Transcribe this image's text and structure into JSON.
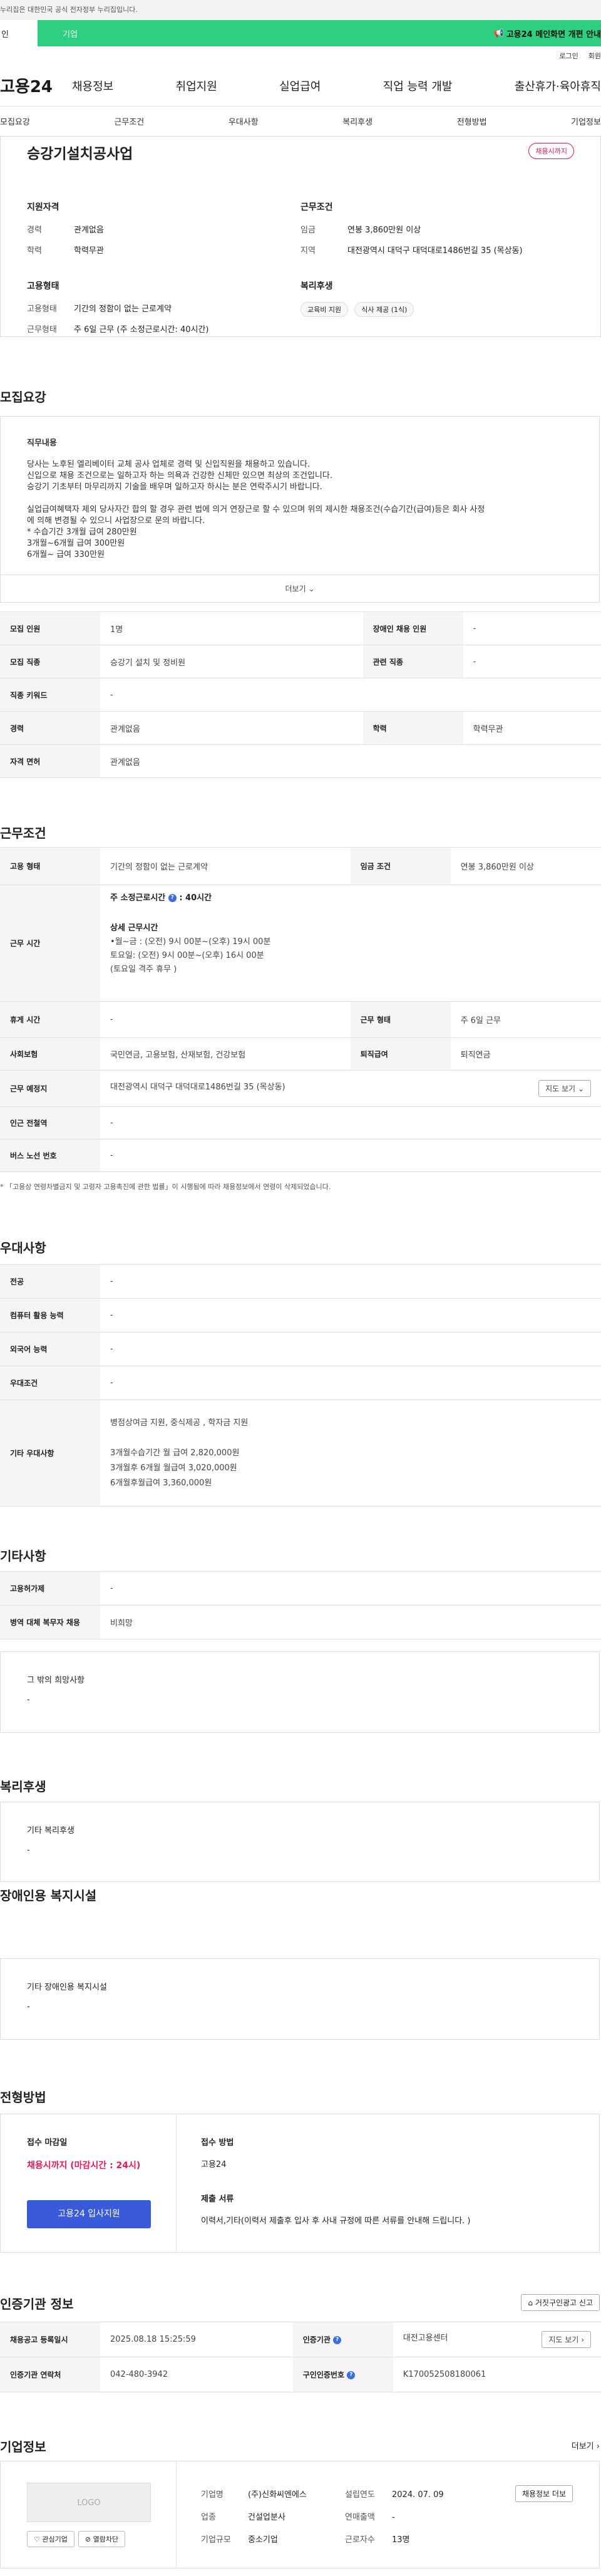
{
  "gov_bar": "누리집은 대한민국 공식 전자정부 누리집입니다.",
  "tabs": {
    "left": "인",
    "right": "기업",
    "banner": "고용24 메인화면 개편 안내"
  },
  "util": {
    "login": "로그인",
    "join": "회원"
  },
  "gnb": {
    "logo": "고용24",
    "menu": [
      "채용정보",
      "취업지원",
      "실업급여",
      "직업 능력 개발",
      "출산휴가·육아휴직"
    ]
  },
  "anchor": [
    "모집요강",
    "근무조건",
    "우대사항",
    "복리후생",
    "전형방법",
    "기업정보"
  ],
  "company_name": "승강기설치공사업",
  "status_badge": "채용시까지",
  "summary": {
    "qual_title": "지원자격",
    "career_k": "경력",
    "career_v": "관계없음",
    "edu_k": "학력",
    "edu_v": "학력무관",
    "emp_title": "고용형태",
    "emp_type_k": "고용형태",
    "emp_type_v": "기간의 정함이 없는 근로계약",
    "work_type_k": "근무형태",
    "work_type_v": "주 6일 근무 (주 소정근로시간: 40시간)",
    "cond_title": "근무조건",
    "wage_k": "임금",
    "wage_v": "연봉 3,860만원 이상",
    "region_k": "지역",
    "region_v": "대전광역시 대덕구 대덕대로1486번길 35 (목상동)",
    "welfare_title": "복리후생",
    "welfare_chips": [
      "교육비 지원",
      "식사 제공 (1식)"
    ]
  },
  "recruit": {
    "title": "모집요강",
    "job_label": "직무내용",
    "lines": [
      "당사는 노후된 엘리베이터 교체 공사 업체로 경력 및 신입직원을 채용하고 있습니다.",
      "신입으로 채용 조건으로는 일하고자 하는 의욕과 건강한 신체만 있으면 최상의 조건입니다.",
      "승강기 기초부터 마무리까지 기술을 배우며 일하고자 하시는 분은 연락주시기 바랍니다.",
      "",
      "실업급여혜택자 제외 당사자간 합의 할 경우 관련 법에 의거 연장근로 할 수 있으며 위의 제시한 채용조건(수습기간(급여)등은 회사 사정",
      "에 의해 변경될 수 있으니 사업장으로 문의 바랍니다.",
      "* 수습기간 3개월 급여 280만원",
      "  3개월~6개월 급여 300만원",
      "  6개월~  급여 330만원"
    ],
    "more": "더보기",
    "rows": [
      {
        "h1": "모집 인원",
        "v1": "1명",
        "h2": "장애인 채용 인원",
        "v2": "-"
      },
      {
        "h1": "모집 직종",
        "v1": "승강기 설치 및 정비원",
        "h2": "관련 직종",
        "v2": "-"
      },
      {
        "h1": "직종 키워드",
        "v1": "-"
      },
      {
        "h1": "경력",
        "v1": "관계없음",
        "h2": "학력",
        "v2": "학력무관"
      },
      {
        "h1": "자격 면허",
        "v1": "관계없음"
      }
    ]
  },
  "work": {
    "title": "근무조건",
    "emp_h": "고용 형태",
    "emp_v": "기간의 정함이 없는 근로계약",
    "wage_h": "임금 조건",
    "wage_v": "연봉 3,860만원 이상",
    "time_h": "근무 시간",
    "time_main": "주 소정근로시간",
    "time_hours": ": 40시간",
    "time_detail_title": "상세 근무시간",
    "time_lines": [
      "•월~금 : (오전) 9시 00분~(오후) 19시 00분",
      "토요일: (오전) 9시 00분~(오후) 16시 00분",
      "(토요일 격주 휴무 )"
    ],
    "rest_h": "휴게 시간",
    "rest_v": "-",
    "form_h": "근무 형태",
    "form_v": "주 6일 근무",
    "ins_h": "사회보험",
    "ins_v": "국민연금, 고용보험, 산재보험, 건강보험",
    "ret_h": "퇴직급여",
    "ret_v": "퇴직연금",
    "place_h": "근무 예정지",
    "place_v": "대전광역시 대덕구 대덕대로1486번길 35 (목상동)",
    "map_btn": "지도 보기",
    "subway_h": "인근 전철역",
    "subway_v": "-",
    "bus_h": "버스 노선 번호",
    "bus_v": "-",
    "note": "* 「고용상 연령차별금지 및 고령자 고용촉진에 관한 법률」이 시행됨에 따라 채용정보에서 연령이 삭제되었습니다."
  },
  "pref": {
    "title": "우대사항",
    "rows": [
      {
        "h": "전공",
        "v": "-"
      },
      {
        "h": "컴퓨터 활용 능력",
        "v": "-"
      },
      {
        "h": "외국어 능력",
        "v": "-"
      },
      {
        "h": "우대조건",
        "v": "-"
      }
    ],
    "other_h": "기타 우대사항",
    "other_lines": [
      "병점상여금 지원, 중식제공 , 학자금 지원",
      "",
      "3개월수습기간 월 급여 2,820,000원",
      "3개월후 6개월 월급여 3,020,000원",
      "6개월후월급여  3,360,000원"
    ]
  },
  "etc": {
    "title": "기타사항",
    "rows": [
      {
        "h": "고용허가제",
        "v": "-"
      },
      {
        "h": "병역 대체 복무자 채용",
        "v": "비희망"
      }
    ],
    "box_label": "그 밖의 희망사항",
    "box_val": "-"
  },
  "welfare": {
    "title": "복리후생",
    "label": "기타 복리후생",
    "val": "-"
  },
  "disab": {
    "title": "장애인용 복지시설",
    "label": "기타 장애인용 복지시설",
    "val": "-"
  },
  "process": {
    "title": "전형방법",
    "deadline_label": "접수 마감일",
    "deadline_val": "채용시까지 (마감시간 : 24시)",
    "apply_btn": "고용24 입사지원",
    "method_label": "접수 방법",
    "method_val": "고용24",
    "docs_label": "제출 서류",
    "docs_val": "이력서,기타(이력서 제출후 입사 후 사내 규정에 따른 서류를 안내해 드립니다. )"
  },
  "cert": {
    "title": "인증기관 정보",
    "report_btn": "거짓구인광고 신고",
    "reg_h": "채용공고 등록일시",
    "reg_v": "2025.08.18 15:25:59",
    "agency_h": "인증기관",
    "agency_v": "대전고용센터",
    "map_btn": "지도 보기",
    "tel_h": "인증기관 연락처",
    "tel_v": "042-480-3942",
    "id_h": "구인인증번호",
    "id_v": "K170052508180061"
  },
  "company": {
    "title": "기업정보",
    "more": "더보기",
    "logo": "LOGO",
    "fav_btn": "관심기업",
    "block_btn": "열람차단",
    "name_k": "기업명",
    "name_v": "(주)신화씨엔에스",
    "est_k": "설립연도",
    "est_v": "2024. 07. 09",
    "ind_k": "업종",
    "ind_v": "건설업분사",
    "sales_k": "연매출액",
    "sales_v": "-",
    "scale_k": "기업규모",
    "scale_v": "중소기업",
    "emp_k": "근로자수",
    "emp_v": "13명",
    "jobs_btn": "채용정보 더보"
  }
}
